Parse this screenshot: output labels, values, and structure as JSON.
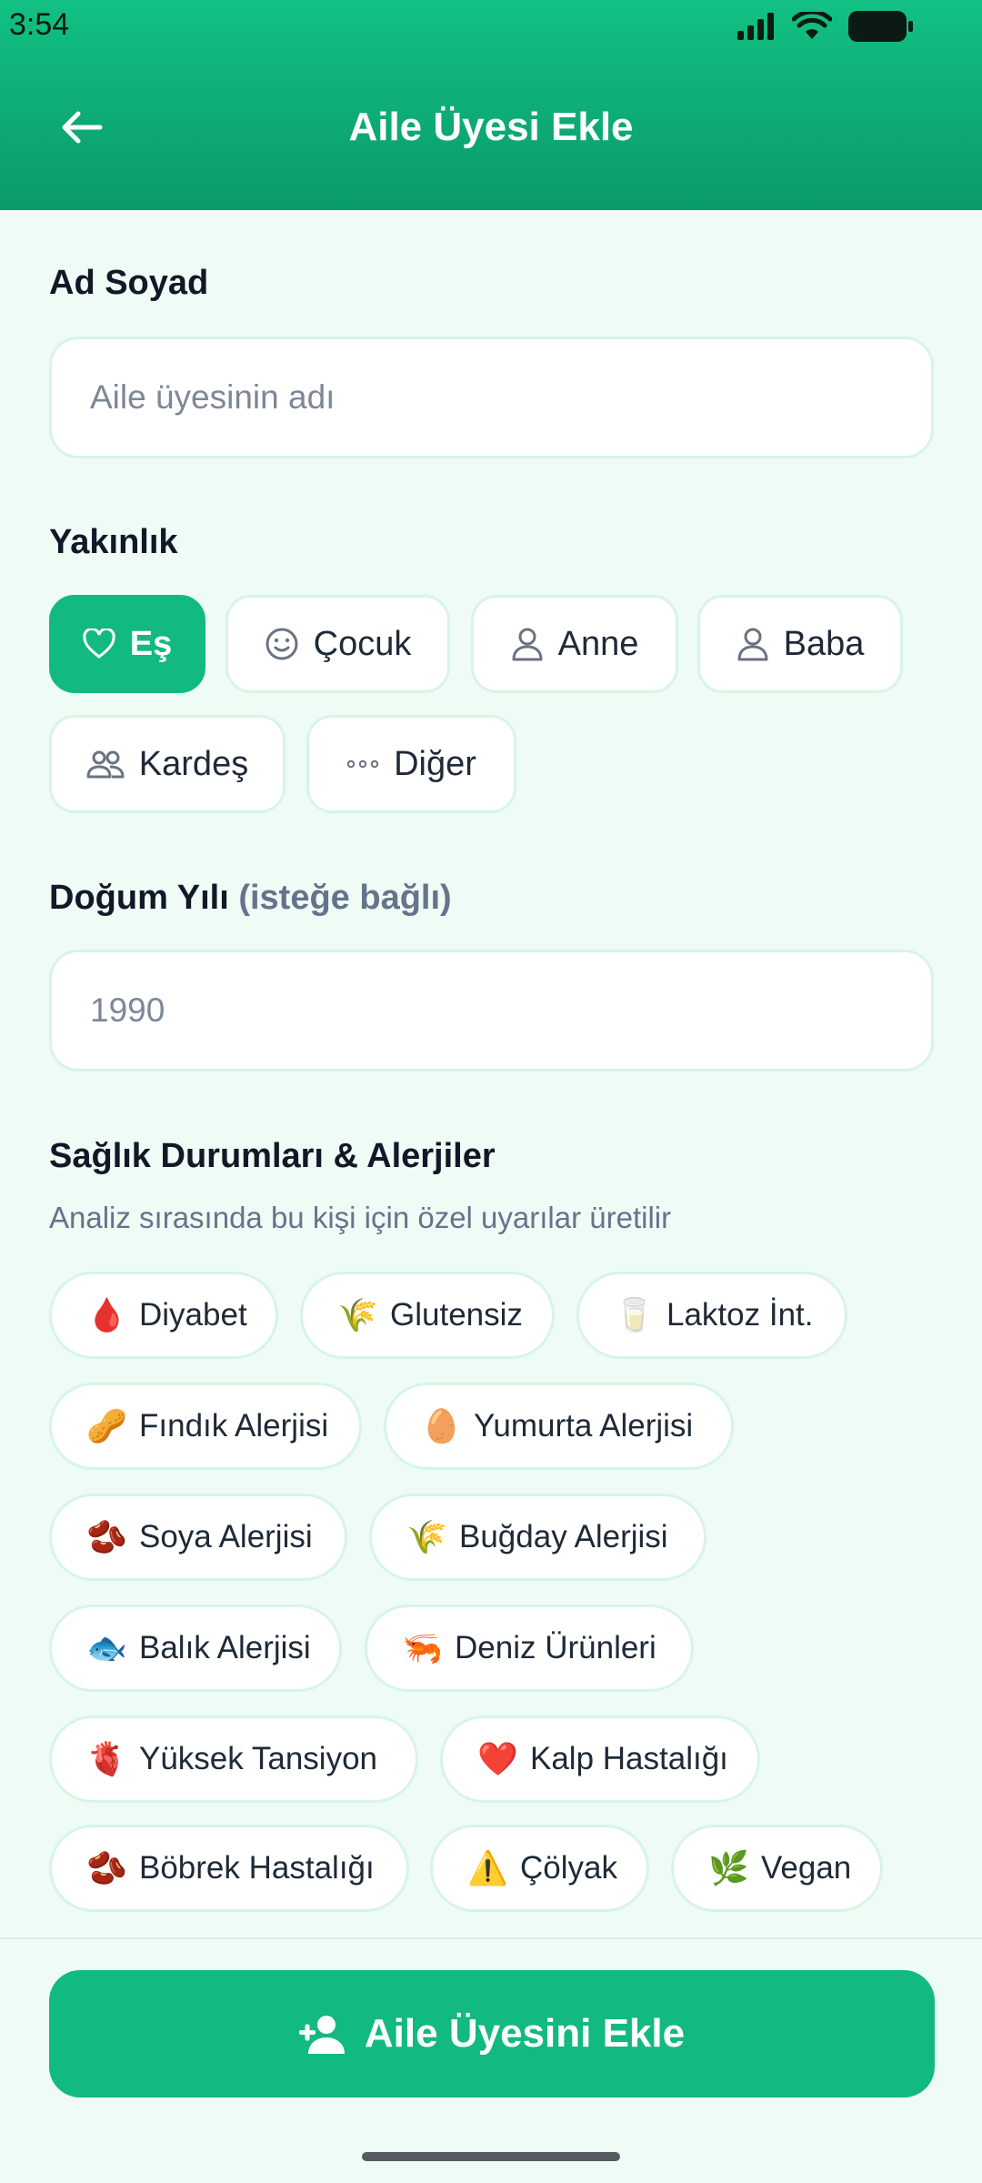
{
  "status_bar": {
    "time": "3:54"
  },
  "header": {
    "title": "Aile Üyesi Ekle"
  },
  "name_section": {
    "label": "Ad Soyad",
    "placeholder": "Aile üyesinin adı"
  },
  "relation_section": {
    "label": "Yakınlık",
    "options": [
      {
        "label": "Eş",
        "icon": "heart-icon",
        "selected": true
      },
      {
        "label": "Çocuk",
        "icon": "smile-icon",
        "selected": false
      },
      {
        "label": "Anne",
        "icon": "person-icon",
        "selected": false
      },
      {
        "label": "Baba",
        "icon": "person-icon",
        "selected": false
      },
      {
        "label": "Kardeş",
        "icon": "people-icon",
        "selected": false
      },
      {
        "label": "Diğer",
        "icon": "more-icon",
        "selected": false
      }
    ]
  },
  "birth_year_section": {
    "label": "Doğum Yılı",
    "optional": "(isteğe bağlı)",
    "placeholder": "1990"
  },
  "health_section": {
    "label": "Sağlık Durumları & Alerjiler",
    "subtitle": "Analiz sırasında bu kişi için özel uyarılar üretilir",
    "tags": [
      {
        "emoji": "🩸",
        "label": "Diyabet"
      },
      {
        "emoji": "🌾",
        "label": "Glutensiz"
      },
      {
        "emoji": "🥛",
        "label": "Laktoz İnt."
      },
      {
        "emoji": "🥜",
        "label": "Fındık Alerjisi"
      },
      {
        "emoji": "🥚",
        "label": "Yumurta Alerjisi"
      },
      {
        "emoji": "🫘",
        "label": "Soya Alerjisi"
      },
      {
        "emoji": "🌾",
        "label": "Buğday Alerjisi"
      },
      {
        "emoji": "🐟",
        "label": "Balık Alerjisi"
      },
      {
        "emoji": "🦐",
        "label": "Deniz Ürünleri"
      },
      {
        "emoji": "🫀",
        "label": "Yüksek Tansiyon"
      },
      {
        "emoji": "❤️",
        "label": "Kalp Hastalığı"
      },
      {
        "emoji": "🫘",
        "label": "Böbrek Hastalığı"
      },
      {
        "emoji": "⚠️",
        "label": "Çölyak"
      },
      {
        "emoji": "🌿",
        "label": "Vegan"
      }
    ]
  },
  "submit_button": {
    "label": "Aile Üyesini Ekle",
    "icon": "add-user-icon"
  },
  "colors": {
    "primary": "#12b981",
    "background": "#effbf5",
    "border": "#d6f5e6"
  }
}
